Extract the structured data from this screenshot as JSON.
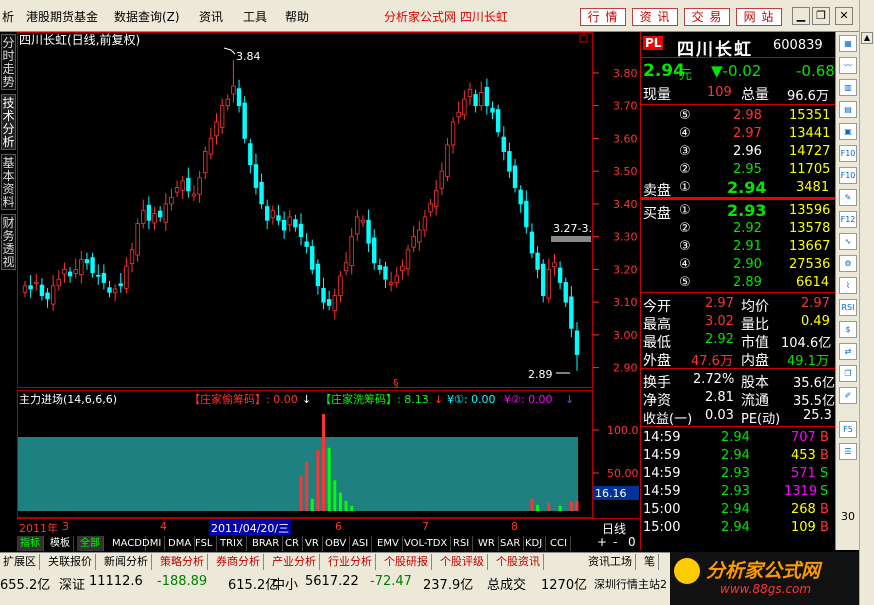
{
  "menu": [
    "析",
    "港股期货基金",
    "数据查询(Z)",
    "资讯",
    "工具",
    "帮助"
  ],
  "app_title": "分析家公式网  四川长虹",
  "top_buttons": [
    "行 情",
    "资 讯",
    "交 易",
    "网 站"
  ],
  "window_buttons": [
    "▁",
    "❐",
    "✕"
  ],
  "left_tabs": [
    "分时走势",
    "技术分析",
    "基本资料",
    "财务透视"
  ],
  "chart": {
    "title": "四川长虹(日线,前复权)",
    "high_label": "3.84",
    "low_label": "2.89",
    "box_label": "3.27-3.",
    "price_ticks": [
      "3.80",
      "3.70",
      "3.60",
      "3.50",
      "3.40",
      "3.30",
      "3.20",
      "3.10",
      "3.00",
      "2.90"
    ],
    "indicator_title": "主力进场(14,6,6,6)",
    "ind_a_label": "【庄家偷筹码】: 0.00",
    "ind_b_label": "【庄家洗筹码】: 8.13",
    "ind_c_label": "¥①: 0.00",
    "ind_d_label": "¥②: 0.00",
    "ind_ticks": [
      "100.0",
      "50.00"
    ],
    "ind_current": "16.16",
    "date_axis": [
      "2011年",
      "3",
      "4",
      "2011/04/20/三",
      "6",
      "7",
      "8"
    ],
    "period_label": "日线",
    "plus": "+",
    "minus": "-",
    "zero": "0"
  },
  "chart_data": {
    "type": "candlestick",
    "ylim": [
      2.85,
      3.87
    ],
    "high": 3.84,
    "low": 2.89,
    "closes": [
      3.15,
      3.14,
      3.16,
      3.12,
      3.11,
      3.15,
      3.17,
      3.2,
      3.18,
      3.2,
      3.23,
      3.22,
      3.19,
      3.18,
      3.16,
      3.13,
      3.14,
      3.15,
      3.21,
      3.26,
      3.34,
      3.38,
      3.35,
      3.37,
      3.36,
      3.4,
      3.42,
      3.45,
      3.47,
      3.44,
      3.43,
      3.48,
      3.56,
      3.6,
      3.65,
      3.7,
      3.72,
      3.76,
      3.7,
      3.6,
      3.52,
      3.45,
      3.4,
      3.35,
      3.38,
      3.35,
      3.32,
      3.36,
      3.33,
      3.3,
      3.27,
      3.2,
      3.15,
      3.1,
      3.09,
      3.12,
      3.18,
      3.22,
      3.3,
      3.36,
      3.35,
      3.28,
      3.22,
      3.2,
      3.17,
      3.16,
      3.18,
      3.21,
      3.26,
      3.3,
      3.32,
      3.36,
      3.4,
      3.44,
      3.5,
      3.58,
      3.65,
      3.68,
      3.72,
      3.75,
      3.7,
      3.74,
      3.7,
      3.68,
      3.62,
      3.56,
      3.5,
      3.45,
      3.4,
      3.33,
      3.25,
      3.2,
      3.12,
      3.2,
      3.22,
      3.16,
      3.1,
      3.02,
      2.94
    ]
  },
  "quote": {
    "logo": "PL",
    "name": "四川长虹",
    "code": "600839",
    "price": "2.94",
    "price_unit": "元",
    "change": "▼-0.02",
    "change_pct": "-0.68",
    "xianliang_label": "现量",
    "xianliang": "109",
    "zongliang_label": "总量",
    "zongliang": "96.6万",
    "sell_label": "卖盘",
    "buy_label": "买盘",
    "sells": [
      {
        "no": "⑤",
        "price": "2.98",
        "vol": "15351"
      },
      {
        "no": "④",
        "price": "2.97",
        "vol": "13441"
      },
      {
        "no": "③",
        "price": "2.96",
        "vol": "14727"
      },
      {
        "no": "②",
        "price": "2.95",
        "vol": "11705"
      },
      {
        "no": "①",
        "price": "2.94",
        "vol": "3481"
      }
    ],
    "buys": [
      {
        "no": "①",
        "price": "2.93",
        "vol": "13596"
      },
      {
        "no": "②",
        "price": "2.92",
        "vol": "13578"
      },
      {
        "no": "③",
        "price": "2.91",
        "vol": "13667"
      },
      {
        "no": "④",
        "price": "2.90",
        "vol": "27536"
      },
      {
        "no": "⑤",
        "price": "2.89",
        "vol": "6614"
      }
    ],
    "stats": [
      {
        "l1": "今开",
        "v1": "2.97",
        "l2": "均价",
        "v2": "2.97"
      },
      {
        "l1": "最高",
        "v1": "3.02",
        "l2": "量比",
        "v2": "0.49"
      },
      {
        "l1": "最低",
        "v1": "2.92",
        "l2": "市值",
        "v2": "104.6亿"
      },
      {
        "l1": "外盘",
        "v1": "47.6万",
        "l2": "内盘",
        "v2": "49.1万"
      }
    ],
    "stats2": [
      {
        "l1": "换手",
        "v1": "2.72%",
        "l2": "股本",
        "v2": "35.6亿"
      },
      {
        "l1": "净资",
        "v1": "2.81",
        "l2": "流通",
        "v2": "35.5亿"
      },
      {
        "l1": "收益(一)",
        "v1": "0.03",
        "l2": "PE(动)",
        "v2": "25.3"
      }
    ],
    "ticks": [
      {
        "t": "14:59",
        "p": "2.94",
        "v": "707",
        "s": "B"
      },
      {
        "t": "14:59",
        "p": "2.94",
        "v": "453",
        "s": "B"
      },
      {
        "t": "14:59",
        "p": "2.93",
        "v": "571",
        "s": "S"
      },
      {
        "t": "14:59",
        "p": "2.93",
        "v": "1319",
        "s": "S"
      },
      {
        "t": "15:00",
        "p": "2.94",
        "v": "268",
        "s": "B"
      },
      {
        "t": "15:00",
        "p": "2.94",
        "v": "109",
        "s": "B"
      }
    ]
  },
  "toolbar_icons": [
    "chart",
    "line",
    "kline",
    "bar",
    "table",
    "F10",
    "F10",
    "tool",
    "F12",
    "wave",
    "tool2",
    "RSI",
    "split",
    "switch",
    "copy",
    "edit",
    "F5",
    "list",
    "30"
  ],
  "ind_tabs": [
    "指标",
    "模板",
    "全部",
    "MACD",
    "DMI",
    "DMA",
    "FSL",
    "TRIX",
    "BRAR",
    "CR",
    "VR",
    "OBV",
    "ASI",
    "EMV",
    "VOL-TDX",
    "RSI",
    "WR",
    "SAR",
    "KDJ",
    "CCI"
  ],
  "bottom_tabs": [
    "扩展区",
    "关联报价",
    "新闻分析",
    "策略分析",
    "券商分析",
    "产业分析",
    "行业分析",
    "个股研报",
    "个股评级",
    "个股资讯",
    "资讯工场",
    "笔"
  ],
  "status": {
    "sh_amount": "655.2亿",
    "sz_label": "深证",
    "sz_index": "11112.6",
    "sz_change": "-188.89",
    "sz_amount": "615.2亿",
    "zx_label": "中小",
    "zx_index": "5617.22",
    "zx_change": "-72.47",
    "zx_amount": "237.9亿",
    "total_label": "总成交",
    "total": "1270亿",
    "server": "深圳行情主站2"
  },
  "brand": {
    "name": "分析家公式网",
    "url": "www.88gs.com"
  }
}
